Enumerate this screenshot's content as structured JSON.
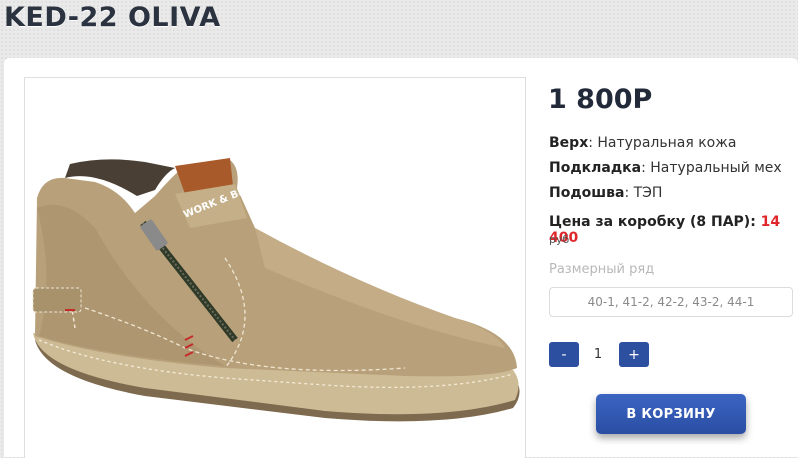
{
  "product": {
    "title": "KED-22 OLIVA",
    "price": "1 800Р",
    "specs": [
      {
        "label": "Верх",
        "value": ": Натуральная кожа"
      },
      {
        "label": "Подкладка",
        "value": ": Натуральный мех"
      },
      {
        "label": "Подошва",
        "value": ": ТЭП"
      }
    ],
    "box_price_label": "Цена за коробку (8 ПАР): ",
    "box_price_value": "14 400",
    "box_price_unit": "руб",
    "size_label": "Размерный ряд",
    "sizes": "40-1, 41-2, 42-2, 43-2, 44-1",
    "image_brand_text": "WORK & BE"
  },
  "quantity": {
    "minus": "-",
    "value": "1",
    "plus": "+"
  },
  "cart_button": "В КОРЗИНУ",
  "colors": {
    "accent_blue": "#2c4fa0",
    "price_red": "#e0262b",
    "leather": "#b8a17a"
  }
}
